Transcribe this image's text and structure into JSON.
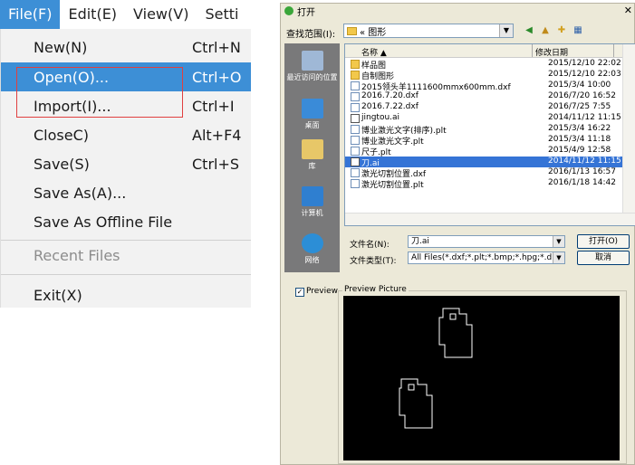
{
  "menubar": {
    "items": [
      "File(F)",
      "Edit(E)",
      "View(V)",
      "Setti"
    ]
  },
  "file_menu": {
    "items": [
      {
        "label": "New(N)",
        "shortcut": "Ctrl+N"
      },
      {
        "label": "Open(O)...",
        "shortcut": "Ctrl+O"
      },
      {
        "label": "Import(I)...",
        "shortcut": "Ctrl+I"
      },
      {
        "label": "CloseC)",
        "shortcut": "Alt+F4"
      },
      {
        "label": "Save(S)",
        "shortcut": "Ctrl+S"
      },
      {
        "label": "Save As(A)...",
        "shortcut": ""
      },
      {
        "label": "Save As Offline File",
        "shortcut": ""
      }
    ],
    "recent_label": "Recent Files",
    "exit_label": "Exit(X)"
  },
  "dialog": {
    "title": "打开",
    "look_in_label": "查找范围(I):",
    "look_in_value": "« 图形",
    "places": [
      "最近访问的位置",
      "桌面",
      "库",
      "计算机",
      "网络"
    ],
    "columns": {
      "name": "名称",
      "date": "修改日期"
    },
    "files": [
      {
        "name": "样品图",
        "date": "2015/12/10 22:02",
        "type": "folder"
      },
      {
        "name": "自制图形",
        "date": "2015/12/10 22:03",
        "type": "folder"
      },
      {
        "name": "2015领头羊1111600mmx600mm.dxf",
        "date": "2015/3/4 10:00",
        "type": "file"
      },
      {
        "name": "2016.7.20.dxf",
        "date": "2016/7/20 16:52",
        "type": "file"
      },
      {
        "name": "2016.7.22.dxf",
        "date": "2016/7/25 7:55",
        "type": "file"
      },
      {
        "name": "jingtou.ai",
        "date": "2014/11/12 11:15",
        "type": "ai"
      },
      {
        "name": "博业激光文字(排序).plt",
        "date": "2015/3/4 16:22",
        "type": "file"
      },
      {
        "name": "博业激光文字.plt",
        "date": "2015/3/4 11:18",
        "type": "file"
      },
      {
        "name": "尺子.plt",
        "date": "2015/4/9 12:58",
        "type": "file"
      },
      {
        "name": "刀.ai",
        "date": "2014/11/12 11:15",
        "type": "ai",
        "selected": true
      },
      {
        "name": "激光切割位置.dxf",
        "date": "2016/1/13 16:57",
        "type": "file"
      },
      {
        "name": "激光切割位置.plt",
        "date": "2016/1/18 14:42",
        "type": "file"
      }
    ],
    "filename_label": "文件名(N):",
    "filename_value": "刀.ai",
    "filetype_label": "文件类型(T):",
    "filetype_value": "All Files(*.dxf;*.plt;*.bmp;*.hpg;*.d",
    "open_button": "打开(O)",
    "cancel_button": "取消",
    "preview_checkbox_label": "Preview",
    "preview_checked": true,
    "preview_group_label": "Preview Picture"
  },
  "colors": {
    "highlight": "#3d8fd6",
    "red_box": "#e04040",
    "selected_row": "#3574d6"
  }
}
